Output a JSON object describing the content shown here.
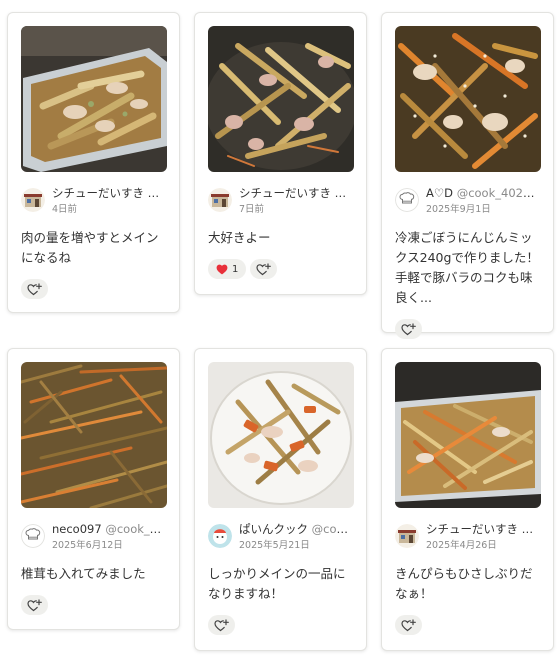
{
  "cards": [
    {
      "author_name": "シチューだいすき",
      "author_handle": "@c...",
      "date": "4日前",
      "comment": "肉の量を増やすとメインになるね",
      "avatar": "house-avatar-icon",
      "reaction_count": ""
    },
    {
      "author_name": "シチューだいすき",
      "author_handle": "@c...",
      "date": "7日前",
      "comment": "大好きよー",
      "avatar": "house-avatar-icon",
      "reaction_count": "1"
    },
    {
      "author_name": "A♡D",
      "author_handle": "@cook_40203...",
      "date": "2025年9月1日",
      "comment": "冷凍ごぼうにんじんミックス240gで作りました！手軽で豚バラのコクも味良く...",
      "avatar": "chef-hat-avatar-icon",
      "reaction_count": ""
    },
    {
      "author_name": "neco097",
      "author_handle": "@cook_40...",
      "date": "2025年6月12日",
      "comment": "椎茸も入れてみました",
      "avatar": "chef-hat-avatar-icon",
      "reaction_count": ""
    },
    {
      "author_name": "ぱいんクック",
      "author_handle": "@cook_...",
      "date": "2025年5月21日",
      "comment": "しっかりメインの一品になりますね！",
      "avatar": "character-avatar-icon",
      "reaction_count": ""
    },
    {
      "author_name": "シチューだいすき",
      "author_handle": "@c...",
      "date": "2025年4月26日",
      "comment": "きんぴらもひさしぶりだなぁ！",
      "avatar": "house-avatar-icon",
      "reaction_count": ""
    }
  ],
  "icons": {
    "add_reaction": "add-reaction-heart-icon",
    "filled_heart": "red-heart-icon"
  },
  "colors": {
    "heart": "#e8303a",
    "button_bg": "#efefec",
    "muted_text": "#8a8a8a"
  }
}
